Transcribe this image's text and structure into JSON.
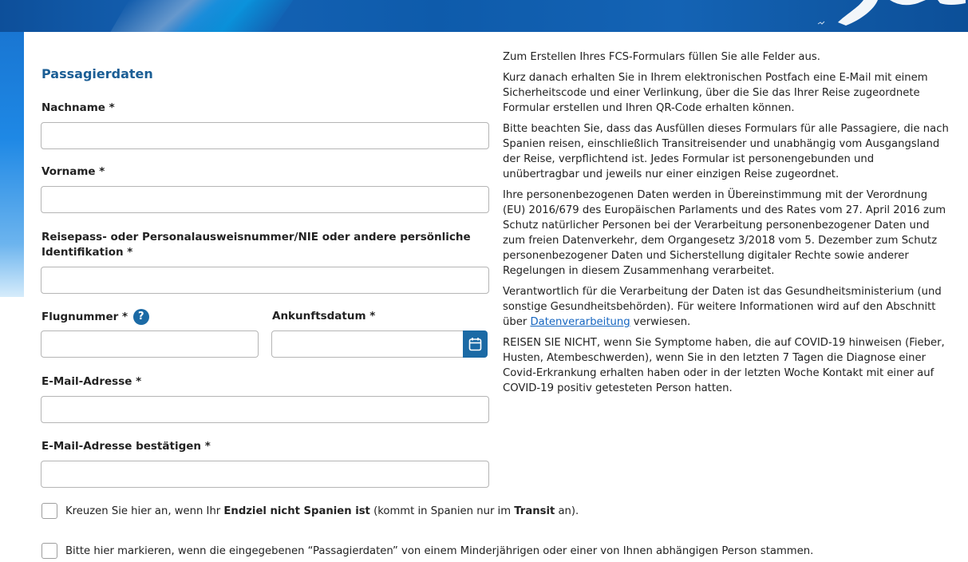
{
  "form": {
    "section_title": "Passagierdaten",
    "lastname_label": "Nachname *",
    "firstname_label": "Vorname *",
    "id_label_line1": "Reisepass- oder Personalausweisnummer/NIE oder andere persönliche",
    "id_label_line2": "Identifikation *",
    "flight_label": "Flugnummer *",
    "flight_help": "?",
    "arrival_label": "Ankunftsdatum *",
    "email_label": "E-Mail-Adresse *",
    "email_confirm_label": "E-Mail-Adresse bestätigen *",
    "lastname_value": "",
    "firstname_value": "",
    "id_value": "",
    "flight_value": "",
    "arrival_value": "",
    "email_value": "",
    "email_confirm_value": ""
  },
  "info": {
    "p1": "Zum Erstellen Ihres FCS-Formulars füllen Sie alle Felder aus.",
    "p2": "Kurz danach erhalten Sie in Ihrem elektronischen Postfach eine E-Mail mit einem Sicherheitscode und einer Verlinkung, über die Sie das Ihrer Reise zugeordnete Formular erstellen und Ihren QR-Code erhalten können.",
    "p3": "Bitte beachten Sie, dass das Ausfüllen dieses Formulars für alle Passagiere, die nach Spanien reisen, einschließlich Transitreisender und unabhängig vom Ausgangsland der Reise, verpflichtend ist. Jedes Formular ist personengebunden und unübertragbar und jeweils nur einer einzigen Reise zugeordnet.",
    "p4": "Ihre personenbezogenen Daten werden in Übereinstimmung mit der Verordnung (EU) 2016/679 des Europäischen Parlaments und des Rates vom 27. April 2016 zum Schutz natürlicher Personen bei der Verarbeitung personenbezogener Daten und zum freien Datenverkehr, dem Organgesetz 3/2018 vom 5. Dezember zum Schutz personenbezogener Daten und Sicherstellung digitaler Rechte sowie anderer Regelungen in diesem Zusammenhang verarbeitet.",
    "p5_before": "Verantwortlich für die Verarbeitung der Daten ist das Gesundheitsministerium (und sonstige Gesundheitsbehörden). Für weitere Informationen wird auf den Abschnitt über ",
    "p5_link": "Datenverarbeitung",
    "p5_after": " verwiesen.",
    "p6": "REISEN SIE NICHT, wenn Sie Symptome haben, die auf COVID-19 hinweisen (Fieber, Husten, Atembeschwerden), wenn Sie in den letzten 7 Tagen die Diagnose einer Covid-Erkrankung erhalten haben oder in der letzten Woche Kontakt mit einer auf COVID-19 positiv getesteten Person hatten."
  },
  "checkboxes": {
    "transit_pre": "Kreuzen Sie hier an, wenn Ihr ",
    "transit_bold1": "Endziel nicht Spanien ist",
    "transit_mid": " (kommt in Spanien nur im ",
    "transit_bold2": "Transit",
    "transit_post": " an).",
    "minor_label": "Bitte hier markieren, wenn die eingegebenen “Passagierdaten” von einem Minderjährigen oder einer von Ihnen abhängigen Person stammen."
  },
  "colors": {
    "accent": "#1b6aa5",
    "title": "#1b5e95",
    "banner": "#0e5bab"
  },
  "icons": {
    "help": "help-icon",
    "calendar": "calendar-icon"
  }
}
